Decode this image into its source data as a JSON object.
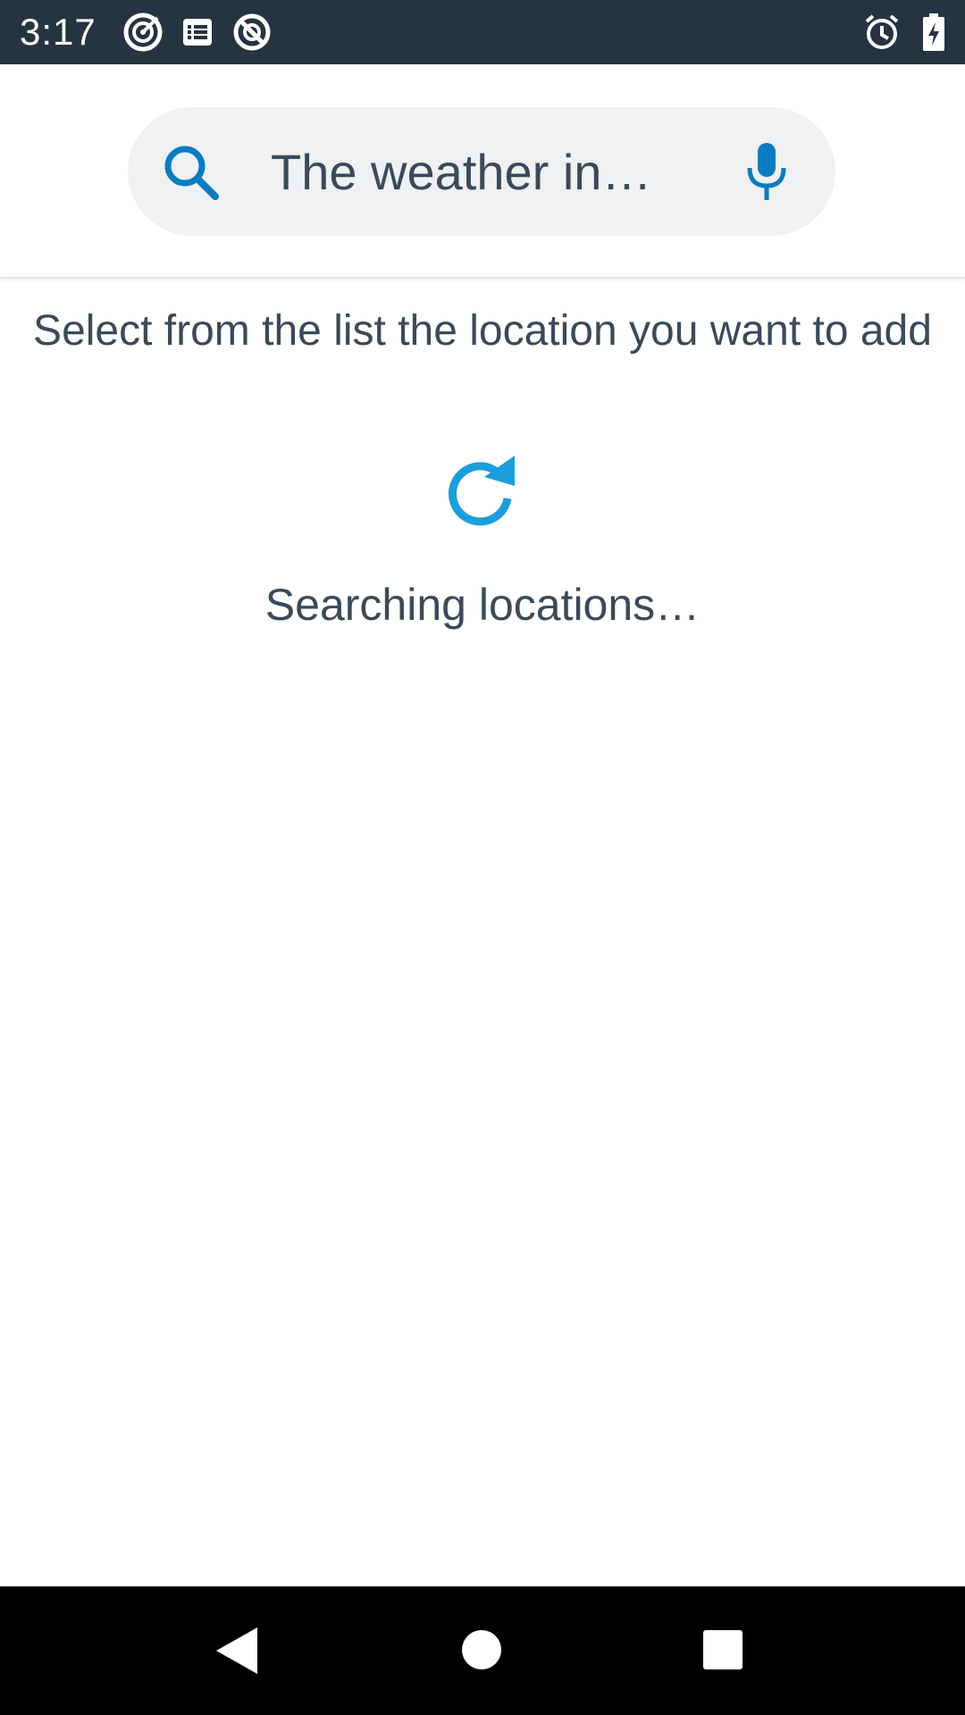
{
  "status_bar": {
    "time": "3:17",
    "left_icons": [
      "target-icon",
      "list-icon",
      "blocked-icon"
    ],
    "right_icons": [
      "alarm-icon",
      "battery-charging-icon"
    ]
  },
  "search": {
    "placeholder": "The weather in…",
    "value": ""
  },
  "content": {
    "instruction": "Select from the list the location you want to add",
    "status": "Searching locations…"
  },
  "nav_bar": {
    "buttons": [
      "back-icon",
      "home-icon",
      "recents-icon"
    ]
  },
  "colors": {
    "status_bar_bg": "#263340",
    "accent": "#0a7cc0",
    "refresh": "#1a9fdc",
    "text": "#3a4a5a",
    "search_bg": "#eff1f3"
  }
}
